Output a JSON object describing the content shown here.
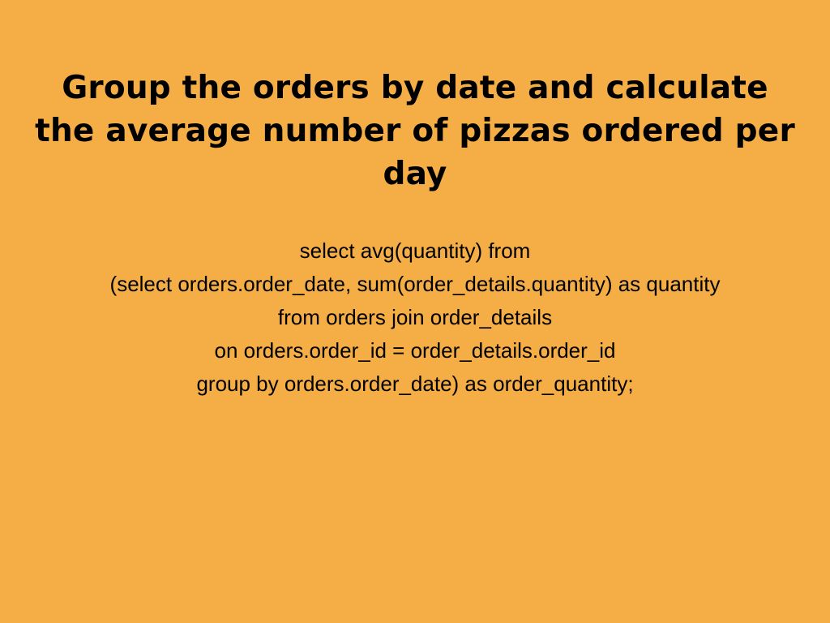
{
  "slide": {
    "background_color": "#f5ad46",
    "text_color": "#000000",
    "title_lines": [
      "Group the orders by date and calculate",
      "the average number of pizzas ordered per",
      "day"
    ],
    "query_lines": [
      "select avg(quantity) from",
      "(select orders.order_date, sum(order_details.quantity) as quantity",
      "from orders join order_details",
      "on orders.order_id = order_details.order_id",
      "group by orders.order_date) as order_quantity;"
    ]
  }
}
